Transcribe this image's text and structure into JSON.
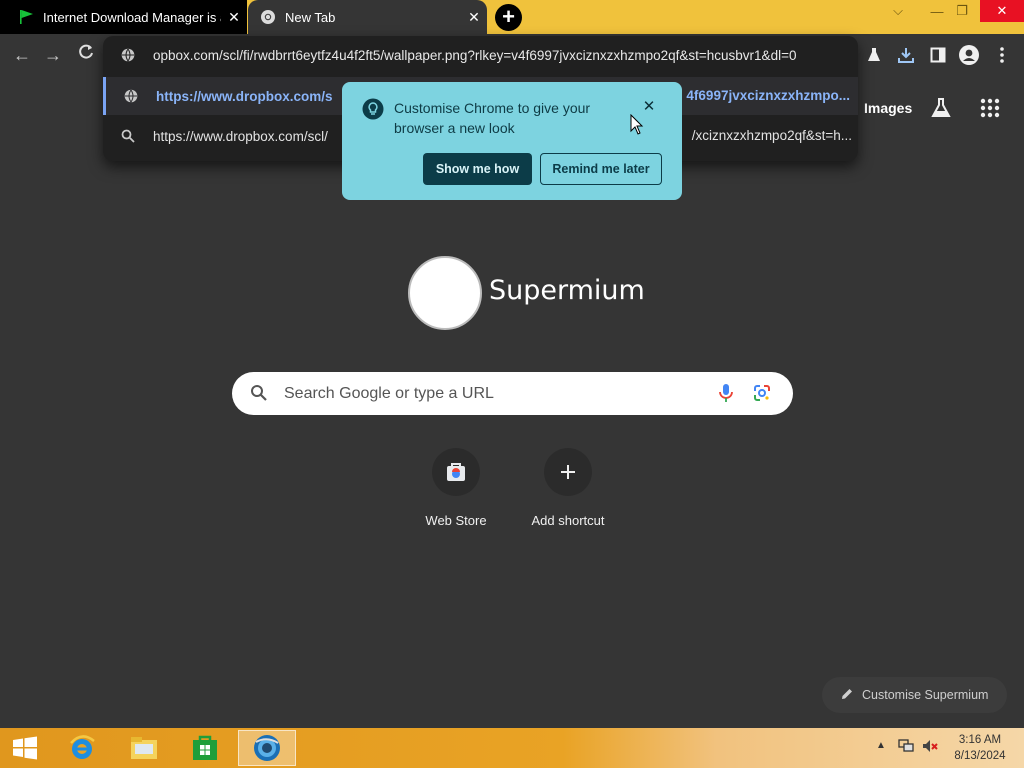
{
  "tabs": [
    {
      "title": "Internet Download Manager is a",
      "icon": "idm-flag-icon"
    },
    {
      "title": "New Tab",
      "icon": "chrome-icon"
    }
  ],
  "omnibox": {
    "input_value": "opbox.com/scl/fi/rwdbrrt6eytfz4u4f2ft5/wallpaper.png?rlkey=v4f6997jvxciznxzxhzmpo2qf&st=hcusbvr1&dl=0",
    "suggestion_url_prefix": "https://www.dropbox.com/s",
    "suggestion_url_tail": "4f6997jvxciznxzxhzmpo...",
    "search_prefix": "https://www.dropbox.com/scl/",
    "search_tail": "/xciznxzxhzmpo2qf&st=h..."
  },
  "bubble": {
    "message": "Customise Chrome to give your browser a new look",
    "primary_label": "Show me how",
    "secondary_label": "Remind me later"
  },
  "ntp": {
    "images_label": "Images",
    "logo_text": "Supermium",
    "search_placeholder": "Search Google or type a URL",
    "shortcuts": [
      {
        "label": "Web Store"
      },
      {
        "label": "Add shortcut"
      }
    ],
    "customise_label": "Customise Supermium"
  },
  "taskbar": {
    "time": "3:16 AM",
    "date": "8/13/2024"
  },
  "colors": {
    "titlebar": "#f0c23c",
    "bubble": "#7dd3e0",
    "link_blue": "#8ab4f8",
    "close_red": "#e81123"
  }
}
